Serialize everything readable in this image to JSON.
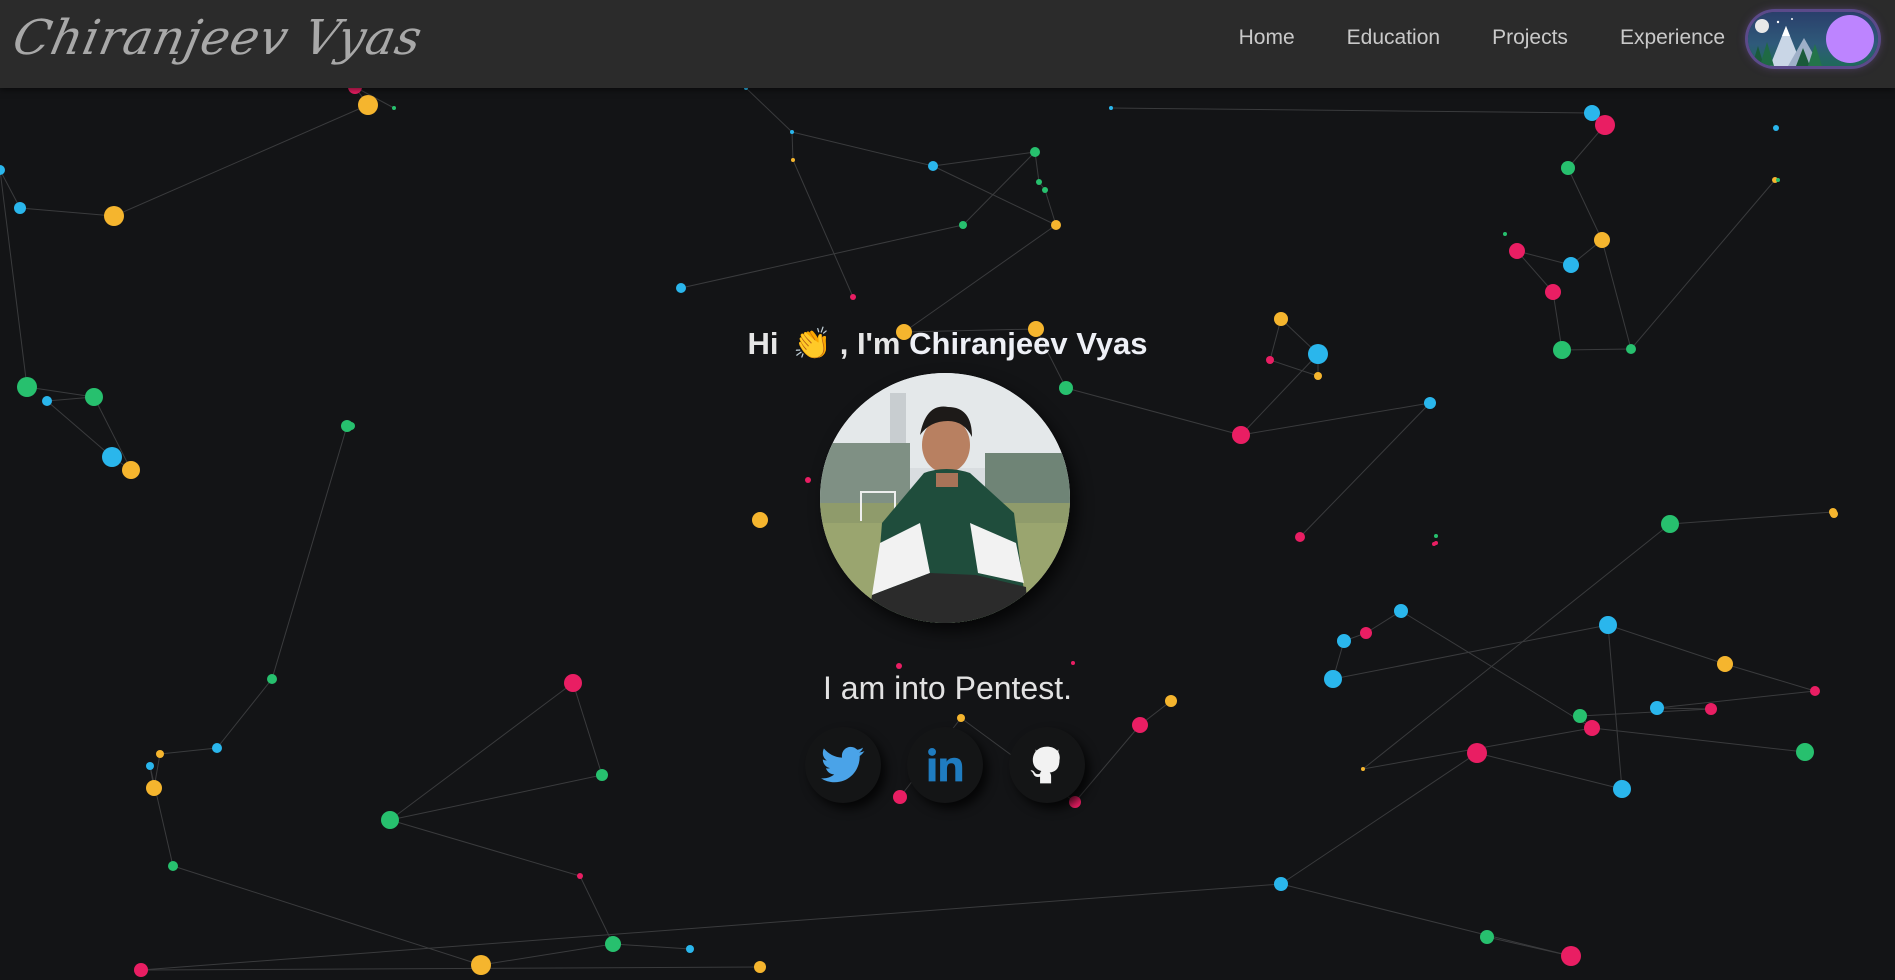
{
  "header": {
    "logo_text": "Chiranjeev Vyas",
    "nav": [
      {
        "label": "Home"
      },
      {
        "label": "Education"
      },
      {
        "label": "Projects"
      },
      {
        "label": "Experience"
      }
    ],
    "theme_toggle": {
      "state": "dark",
      "knob_color": "#bd84ff"
    }
  },
  "hero": {
    "greeting_prefix": "Hi",
    "wave_emoji": "👏",
    "greeting_middle": ", I'm",
    "name": "Chiranjeev Vyas",
    "tagline": "I am into Pentest.",
    "avatar_icon": "profile-photo"
  },
  "socials": [
    {
      "icon": "twitter-icon",
      "color": "#4aa3e8"
    },
    {
      "icon": "linkedin-icon",
      "color": "#1f7cc0"
    },
    {
      "icon": "github-icon",
      "color": "#f2f2f2"
    }
  ],
  "background": {
    "style": "particle-network",
    "colors": [
      "#e91e63",
      "#f5b52e",
      "#27c06e",
      "#2ab6ec"
    ]
  }
}
